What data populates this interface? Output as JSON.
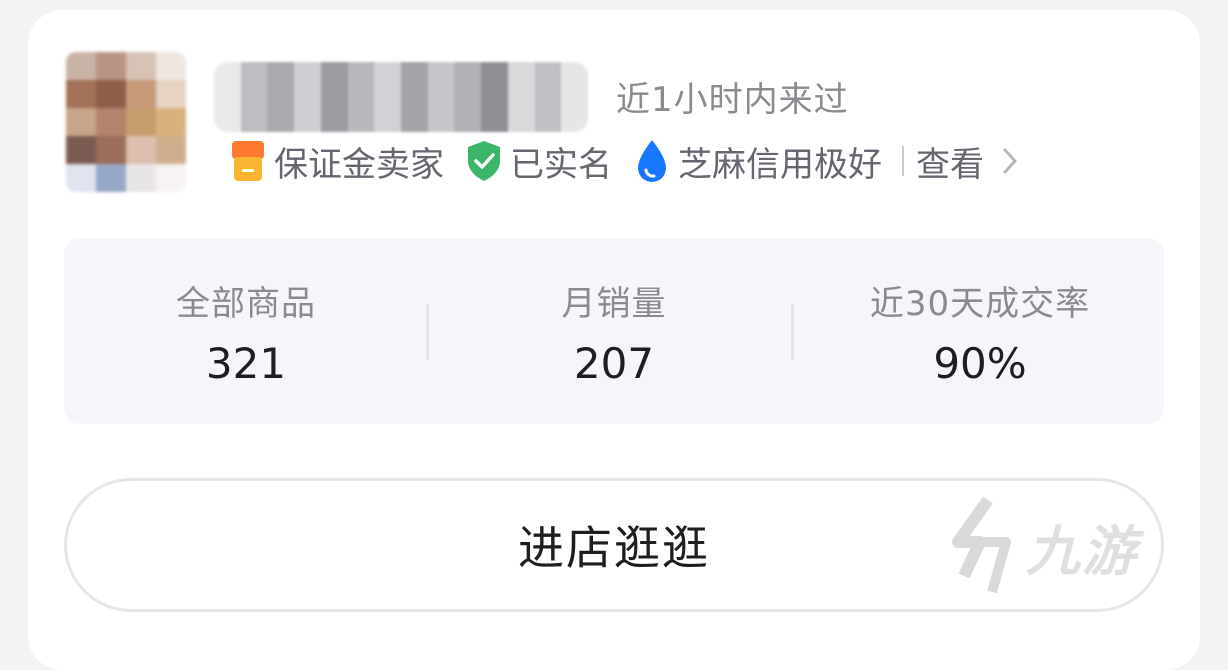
{
  "seller": {
    "last_seen": "近1小时内来过",
    "badges": {
      "deposit": "保证金卖家",
      "verified": "已实名",
      "credit": "芝麻信用极好"
    },
    "view_label": "查看",
    "icons": [
      "store-icon",
      "shield-check-icon",
      "drop-icon",
      "chevron-right-icon"
    ]
  },
  "stats": [
    {
      "label": "全部商品",
      "value": "321"
    },
    {
      "label": "月销量",
      "value": "207"
    },
    {
      "label": "近30天成交率",
      "value": "90%"
    }
  ],
  "enter_button": "进店逛逛",
  "watermark": "九游",
  "colors": {
    "accent_orange": "#f5a623",
    "verified_green": "#3bb56a",
    "credit_blue": "#1677ff",
    "text_primary": "#1d1d22",
    "text_secondary": "#8a8a8f"
  }
}
